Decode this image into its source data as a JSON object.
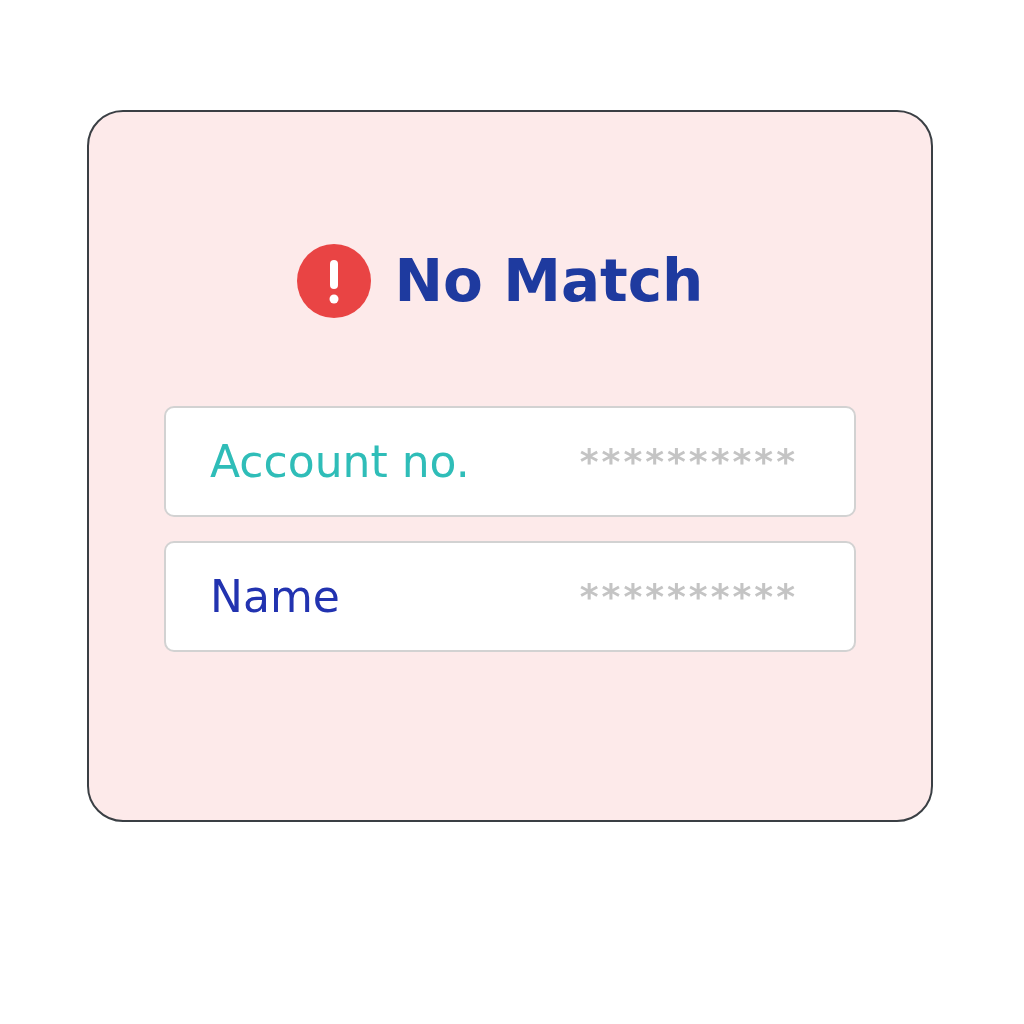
{
  "title": "No Match",
  "status_icon": {
    "kind": "error"
  },
  "fields": [
    {
      "label": "Account no.",
      "value": "**********",
      "color": "#2fbdb8"
    },
    {
      "label": "Name",
      "value": "**********",
      "color": "#2233b0"
    }
  ]
}
